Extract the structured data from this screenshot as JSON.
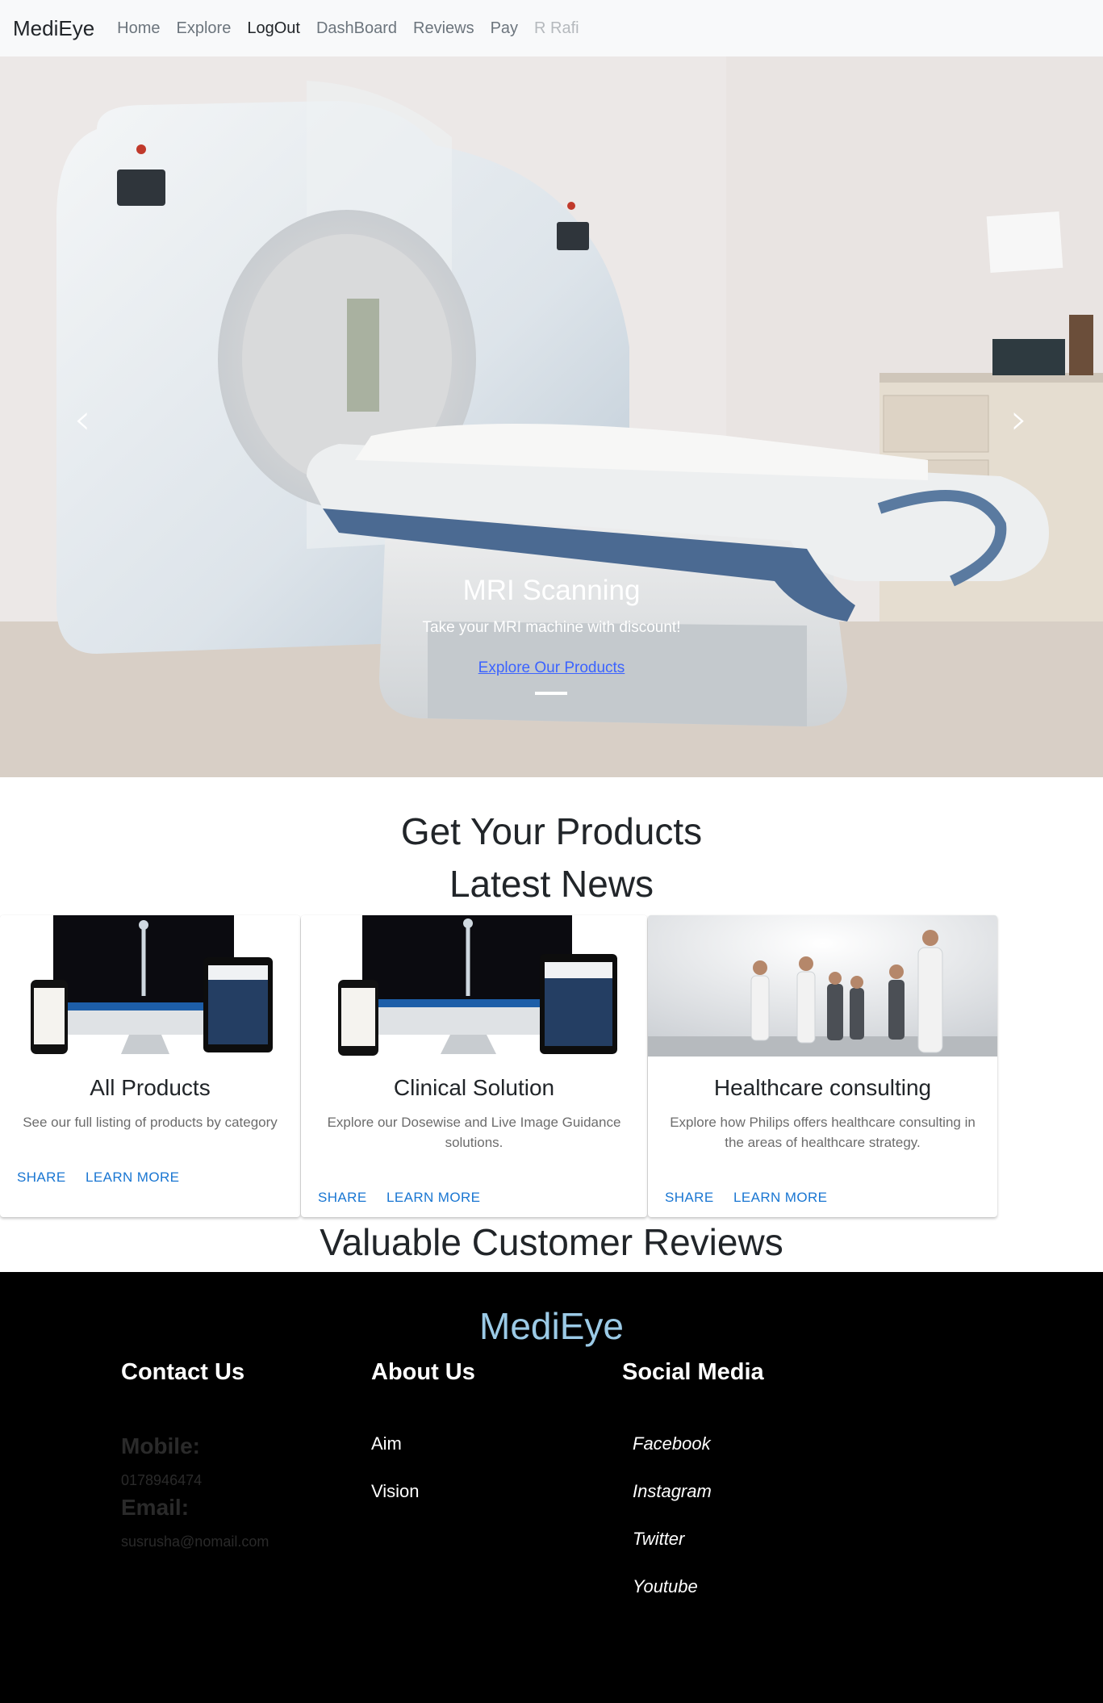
{
  "navbar": {
    "brand": "MediEye",
    "links": [
      {
        "label": "Home"
      },
      {
        "label": "Explore"
      },
      {
        "label": "LogOut"
      },
      {
        "label": "DashBoard"
      },
      {
        "label": "Reviews"
      },
      {
        "label": "Pay"
      },
      {
        "label": "R Rafi"
      }
    ]
  },
  "hero": {
    "title": "MRI Scanning",
    "subtitle": "Take your MRI machine with discount!",
    "link_label": "Explore Our Products",
    "prev_icon": "chevron-left",
    "next_icon": "chevron-right"
  },
  "sections": {
    "products_heading": "Get Your Products",
    "news_heading": "Latest News",
    "reviews_heading": "Valuable Customer Reviews"
  },
  "cards": [
    {
      "title": "All Products",
      "text": "See our full listing of products by category",
      "share": "SHARE",
      "learn": "LEARN MORE"
    },
    {
      "title": "Clinical Solution",
      "text": "Explore our Dosewise and Live Image Guidance solutions.",
      "share": "SHARE",
      "learn": "LEARN MORE"
    },
    {
      "title": "Healthcare consulting",
      "text": "Explore how Philips offers healthcare consulting in the areas of healthcare strategy.",
      "share": "SHARE",
      "learn": "LEARN MORE"
    }
  ],
  "footer": {
    "brand": "MediEye",
    "contact": {
      "heading": "Contact Us",
      "mobile_label": "Mobile:",
      "mobile": "0178946474",
      "email_label": "Email:",
      "email": "susrusha@nomail.com"
    },
    "about": {
      "heading": "About Us",
      "items": [
        "Aim",
        "Vision"
      ]
    },
    "social": {
      "heading": "Social Media",
      "items": [
        "Facebook",
        "Instagram",
        "Twitter",
        "Youtube"
      ]
    }
  },
  "colors": {
    "navbar_bg": "#f8f9fa",
    "footer_bg": "#000000",
    "footer_brand": "#9bcae6",
    "card_button": "#1976d2",
    "hero_link": "#3b63ff"
  }
}
